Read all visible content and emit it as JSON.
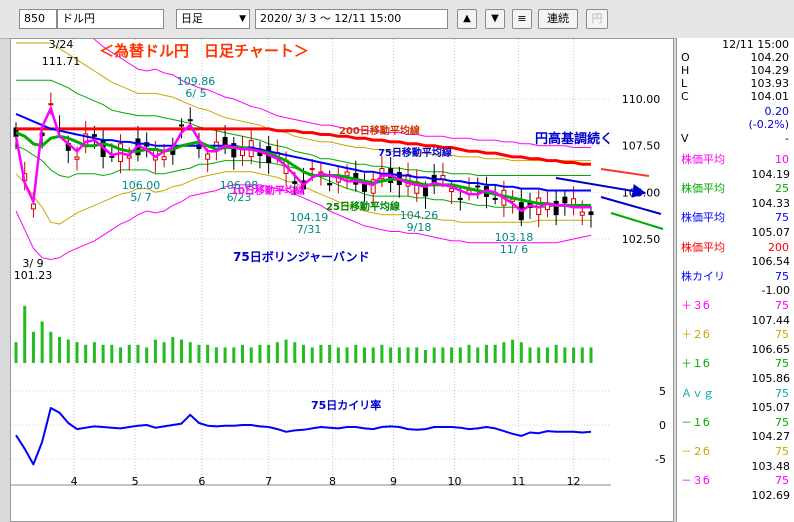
{
  "toolbar": {
    "code": "850",
    "name": "ドル円",
    "period": "日足",
    "date_range": "2020/ 3/ 3 ～ 12/11 15:00",
    "up_button": "▲",
    "down_button": "▼",
    "menu_button": "≡",
    "continuous_button": "連続",
    "yen_button": "円"
  },
  "ohlc": {
    "datetime": "12/11 15:00",
    "rows": [
      {
        "label": "O",
        "value": "104.20"
      },
      {
        "label": "H",
        "value": "104.29"
      },
      {
        "label": "L",
        "value": "103.93"
      },
      {
        "label": "C",
        "value": "104.01"
      }
    ],
    "change": "0.20",
    "change_pct": "(-0.2%)",
    "volume_label": "V",
    "volume_value": "-"
  },
  "indicators": [
    {
      "label": "株価平均",
      "period": "10",
      "value": "104.19",
      "color": "#ff00ff"
    },
    {
      "label": "株価平均",
      "period": "25",
      "value": "104.33",
      "color": "#00aa00"
    },
    {
      "label": "株価平均",
      "period": "75",
      "value": "105.07",
      "color": "#0000ff"
    },
    {
      "label": "株価平均",
      "period": "200",
      "value": "106.54",
      "color": "#ff0000"
    },
    {
      "label": "株カイリ",
      "period": "75",
      "value": "-1.00",
      "color": "#0000ff"
    },
    {
      "label": "＋３б",
      "period": "75",
      "value": "107.44",
      "color": "#ff00ff"
    },
    {
      "label": "＋２б",
      "period": "75",
      "value": "106.65",
      "color": "#c8a800"
    },
    {
      "label": "＋１б",
      "period": "75",
      "value": "105.86",
      "color": "#00aa00"
    },
    {
      "label": "Ａｖｇ",
      "period": "75",
      "value": "105.07",
      "color": "#00aaaa"
    },
    {
      "label": "－１б",
      "period": "75",
      "value": "104.27",
      "color": "#00aa00"
    },
    {
      "label": "－２б",
      "period": "75",
      "value": "103.48",
      "color": "#c8a800"
    },
    {
      "label": "－３б",
      "period": "75",
      "value": "102.69",
      "color": "#ff00ff"
    }
  ],
  "annotations": {
    "title": "＜為替ドル円　日足チャート＞",
    "trend": "円高基調続く",
    "ma200": "200日移動平均線",
    "ma75": "75日移動平均線",
    "ma10": "10日移動平均線",
    "ma25": "25日移動平均線",
    "bollinger": "75日ボリンジャーバンド",
    "deviation": "75日カイリ率"
  },
  "point_labels": [
    {
      "value": "111.71",
      "date": "3/24"
    },
    {
      "value": "101.23",
      "date": "3/ 9"
    },
    {
      "value": "109.86",
      "date": "6/ 5"
    },
    {
      "value": "106.00",
      "date": "5/ 7"
    },
    {
      "value": "106.08",
      "date": "6/23"
    },
    {
      "value": "104.19",
      "date": "7/31"
    },
    {
      "value": "104.26",
      "date": "9/18"
    },
    {
      "value": "103.18",
      "date": "11/ 6"
    }
  ],
  "chart_data": {
    "type": "line",
    "x_ticks": [
      "4",
      "5",
      "6",
      "7",
      "8",
      "9",
      "10",
      "11",
      "12"
    ],
    "price_axis": {
      "ticks": [
        "110.00",
        "107.50",
        "105.00",
        "102.50"
      ],
      "values": [
        110,
        107.5,
        105,
        102.5
      ]
    },
    "deviation_axis": {
      "ticks": [
        "5",
        "0",
        "-5"
      ],
      "values": [
        5,
        0,
        -5
      ]
    },
    "x": [
      0,
      3,
      6,
      9,
      12,
      15,
      18,
      21,
      24,
      27,
      30,
      33,
      36,
      39,
      42,
      45,
      48,
      51,
      54,
      57,
      60,
      63,
      66,
      69,
      72,
      75,
      78,
      81,
      84,
      87,
      90,
      93,
      96,
      99,
      102,
      105,
      108,
      111,
      114,
      117,
      120,
      123,
      126,
      129,
      132,
      135,
      138,
      141,
      144,
      147,
      150,
      153,
      156,
      159,
      162,
      165,
      168,
      171,
      174,
      177,
      180,
      183,
      186,
      189,
      192,
      195,
      198
    ],
    "series": [
      {
        "name": "株価平均 10",
        "color": "#ff00ff",
        "values": [
          108.0,
          105.5,
          104.5,
          108.5,
          109.5,
          108.0,
          107.6,
          107.2,
          107.7,
          107.8,
          107.4,
          107.0,
          107.1,
          107.0,
          107.5,
          107.3,
          106.9,
          107.2,
          107.4,
          108.2,
          108.6,
          107.8,
          107.2,
          107.2,
          107.5,
          107.4,
          107.3,
          107.3,
          107.2,
          107.0,
          106.8,
          106.4,
          105.9,
          105.4,
          105.8,
          106.0,
          105.9,
          105.8,
          105.6,
          105.6,
          105.5,
          105.4,
          105.9,
          105.9,
          105.7,
          105.5,
          105.4,
          105.3,
          105.5,
          105.4,
          105.3,
          105.1,
          104.9,
          104.9,
          105.1,
          105.0,
          104.7,
          104.4,
          104.0,
          104.3,
          104.2,
          104.4,
          104.3,
          104.3,
          104.2,
          104.2,
          104.2
        ]
      },
      {
        "name": "株価平均 25",
        "color": "#00aa00",
        "values": [
          108.2,
          108.0,
          107.6,
          107.5,
          107.9,
          108.0,
          107.9,
          107.7,
          107.5,
          107.5,
          107.6,
          107.5,
          107.3,
          107.2,
          107.2,
          107.3,
          107.3,
          107.2,
          107.3,
          107.5,
          107.6,
          107.7,
          107.5,
          107.3,
          107.4,
          107.4,
          107.4,
          107.3,
          107.2,
          107.1,
          106.9,
          106.7,
          106.4,
          106.1,
          105.9,
          105.9,
          105.9,
          105.9,
          105.8,
          105.7,
          105.6,
          105.5,
          105.6,
          105.7,
          105.7,
          105.6,
          105.5,
          105.4,
          105.4,
          105.4,
          105.4,
          105.3,
          105.2,
          105.1,
          105.0,
          104.9,
          104.8,
          104.7,
          104.6,
          104.5,
          104.4,
          104.4,
          104.3,
          104.3,
          104.3,
          104.3,
          104.3
        ]
      },
      {
        "name": "株価平均 75",
        "color": "#0000ff",
        "values": [
          109.2,
          109.0,
          108.8,
          108.6,
          108.4,
          108.3,
          108.2,
          108.1,
          108.0,
          107.9,
          107.8,
          107.8,
          107.7,
          107.7,
          107.6,
          107.6,
          107.5,
          107.5,
          107.5,
          107.5,
          107.5,
          107.5,
          107.5,
          107.5,
          107.5,
          107.5,
          107.4,
          107.4,
          107.3,
          107.2,
          107.1,
          107.0,
          106.9,
          106.8,
          106.7,
          106.6,
          106.5,
          106.4,
          106.3,
          106.2,
          106.1,
          106.1,
          106.0,
          106.0,
          105.9,
          105.9,
          105.8,
          105.8,
          105.7,
          105.7,
          105.6,
          105.6,
          105.5,
          105.5,
          105.4,
          105.4,
          105.3,
          105.3,
          105.2,
          105.2,
          105.2,
          105.1,
          105.1,
          105.1,
          105.1,
          105.1,
          105.1
        ]
      },
      {
        "name": "株価平均 200",
        "color": "#ff0000",
        "values": [
          108.4,
          108.4,
          108.4,
          108.4,
          108.4,
          108.4,
          108.4,
          108.4,
          108.4,
          108.4,
          108.4,
          108.4,
          108.4,
          108.4,
          108.4,
          108.4,
          108.4,
          108.4,
          108.4,
          108.4,
          108.4,
          108.4,
          108.4,
          108.4,
          108.4,
          108.4,
          108.4,
          108.4,
          108.4,
          108.4,
          108.3,
          108.3,
          108.3,
          108.2,
          108.2,
          108.1,
          108.1,
          108.0,
          108.0,
          107.9,
          107.9,
          107.8,
          107.8,
          107.7,
          107.7,
          107.6,
          107.6,
          107.5,
          107.5,
          107.4,
          107.4,
          107.3,
          107.2,
          107.2,
          107.1,
          107.1,
          107.0,
          106.9,
          106.9,
          106.8,
          106.8,
          106.7,
          106.7,
          106.6,
          106.6,
          106.5,
          106.5
        ]
      },
      {
        "name": "＋３б",
        "color": "#ff00ff",
        "values": [
          115.0,
          115.0,
          115.0,
          115.0,
          115.0,
          114.6,
          114.2,
          113.8,
          113.5,
          113.2,
          112.8,
          112.5,
          112.2,
          111.9,
          111.6,
          111.5,
          111.6,
          111.4,
          111.3,
          111.0,
          110.8,
          110.6,
          110.5,
          110.3,
          110.1,
          110.0,
          109.8,
          109.6,
          109.5,
          109.3,
          109.1,
          109.0,
          108.9,
          108.8,
          108.7,
          108.6,
          108.6,
          108.5,
          108.4,
          108.4,
          108.3,
          108.3,
          108.2,
          108.2,
          108.2,
          108.1,
          108.1,
          108.0,
          108.0,
          108.0,
          107.9,
          107.9,
          107.9,
          107.8,
          107.8,
          107.8,
          107.7,
          107.7,
          107.6,
          107.6,
          107.5,
          107.5,
          107.5,
          107.5,
          107.4,
          107.4,
          107.4
        ]
      },
      {
        "name": "＋２б",
        "color": "#c8a800",
        "values": [
          113.0,
          113.0,
          113.0,
          113.0,
          113.0,
          112.7,
          112.4,
          112.1,
          111.8,
          111.5,
          111.2,
          110.9,
          110.7,
          110.5,
          110.3,
          110.3,
          110.3,
          110.2,
          110.1,
          109.9,
          109.7,
          109.5,
          109.4,
          109.2,
          109.0,
          108.9,
          108.8,
          108.7,
          108.6,
          108.4,
          108.3,
          108.2,
          108.0,
          107.9,
          107.8,
          107.7,
          107.7,
          107.6,
          107.5,
          107.4,
          107.4,
          107.3,
          107.3,
          107.2,
          107.2,
          107.2,
          107.1,
          107.1,
          107.0,
          107.0,
          107.0,
          106.9,
          106.9,
          106.9,
          106.8,
          106.8,
          106.8,
          106.7,
          106.7,
          106.7,
          106.7,
          106.7,
          106.7,
          106.7,
          106.7,
          106.7,
          106.7
        ]
      },
      {
        "name": "＋１б",
        "color": "#00aa00",
        "values": [
          111.0,
          111.0,
          111.0,
          111.0,
          111.0,
          110.8,
          110.6,
          110.3,
          110.1,
          109.9,
          109.7,
          109.4,
          109.3,
          109.2,
          109.1,
          109.1,
          109.1,
          109.0,
          108.9,
          108.8,
          108.7,
          108.5,
          108.4,
          108.3,
          108.2,
          108.1,
          108.0,
          107.9,
          107.8,
          107.6,
          107.5,
          107.4,
          107.2,
          107.1,
          107.0,
          106.8,
          106.8,
          106.7,
          106.6,
          106.5,
          106.5,
          106.4,
          106.4,
          106.3,
          106.3,
          106.2,
          106.2,
          106.1,
          106.1,
          106.1,
          106.0,
          106.0,
          106.0,
          105.9,
          105.9,
          105.9,
          105.9,
          105.9,
          105.9,
          105.9,
          105.9,
          105.9,
          105.9,
          105.9,
          105.9,
          105.9,
          105.9
        ]
      },
      {
        "name": "－１б",
        "color": "#00aa00",
        "values": [
          107.5,
          107.3,
          107.0,
          106.7,
          106.2,
          105.9,
          105.8,
          106.0,
          106.0,
          106.0,
          105.9,
          106.0,
          106.2,
          106.2,
          106.2,
          106.2,
          106.0,
          106.0,
          106.1,
          106.2,
          106.3,
          106.5,
          106.5,
          106.6,
          106.7,
          106.7,
          106.7,
          106.7,
          106.6,
          106.6,
          106.5,
          106.4,
          106.3,
          106.1,
          106.0,
          105.8,
          105.6,
          105.4,
          105.2,
          105.1,
          104.9,
          104.8,
          104.8,
          104.8,
          104.8,
          104.8,
          104.7,
          104.7,
          104.6,
          104.6,
          104.5,
          104.5,
          104.4,
          104.3,
          104.3,
          104.2,
          104.2,
          104.2,
          104.2,
          104.2,
          104.2,
          104.2,
          104.3,
          104.3,
          104.3,
          104.3,
          104.3
        ]
      },
      {
        "name": "－２б",
        "color": "#c8a800",
        "values": [
          106.0,
          105.5,
          104.8,
          104.2,
          103.4,
          103.3,
          103.6,
          103.9,
          104.1,
          104.3,
          104.5,
          104.7,
          104.9,
          105.0,
          105.2,
          105.2,
          105.0,
          105.1,
          105.3,
          105.4,
          105.6,
          105.8,
          105.9,
          106.0,
          106.1,
          106.1,
          106.1,
          106.1,
          106.0,
          105.9,
          105.8,
          105.6,
          105.5,
          105.3,
          105.1,
          104.9,
          104.7,
          104.5,
          104.3,
          104.2,
          104.0,
          103.9,
          103.8,
          103.8,
          103.8,
          103.8,
          103.7,
          103.6,
          103.6,
          103.5,
          103.5,
          103.4,
          103.4,
          103.4,
          103.4,
          103.4,
          103.4,
          103.4,
          103.4,
          103.4,
          103.5,
          103.5,
          103.5,
          103.5,
          103.5,
          103.5,
          103.5
        ]
      },
      {
        "name": "－３б",
        "color": "#ff00ff",
        "values": [
          104.0,
          103.0,
          102.0,
          101.5,
          101.4,
          101.5,
          101.8,
          102.0,
          102.2,
          102.4,
          102.7,
          103.0,
          103.3,
          103.5,
          103.8,
          104.0,
          103.9,
          104.0,
          104.3,
          104.5,
          104.8,
          104.9,
          105.0,
          105.1,
          105.3,
          105.4,
          105.4,
          105.4,
          105.4,
          105.3,
          105.2,
          105.1,
          104.9,
          104.7,
          104.5,
          104.3,
          104.0,
          103.8,
          103.6,
          103.4,
          103.2,
          103.1,
          103.0,
          102.9,
          102.9,
          102.8,
          102.8,
          102.7,
          102.6,
          102.5,
          102.4,
          102.4,
          102.3,
          102.3,
          102.3,
          102.3,
          102.3,
          102.3,
          102.3,
          102.3,
          102.3,
          102.3,
          102.3,
          102.4,
          102.5,
          102.6,
          102.7
        ]
      },
      {
        "name": "75日カイリ率",
        "color": "#0000ff",
        "values": [
          -1.5,
          -3.5,
          -5.8,
          -2.5,
          2.5,
          1.8,
          0.3,
          -0.6,
          -0.4,
          -0.2,
          -0.3,
          -0.4,
          -0.5,
          -0.3,
          -0.1,
          0.0,
          -0.4,
          -0.2,
          0.0,
          0.2,
          1.5,
          0.3,
          -0.1,
          -0.2,
          -0.1,
          -0.1,
          0.0,
          0.0,
          -0.2,
          -0.3,
          -0.6,
          -1.0,
          -0.8,
          -0.7,
          -0.5,
          -0.3,
          -0.4,
          -0.5,
          -0.3,
          -0.3,
          -0.5,
          -0.6,
          -0.3,
          -0.2,
          -0.3,
          -0.6,
          -0.7,
          -0.6,
          -0.3,
          -0.3,
          -0.3,
          -0.4,
          -0.6,
          -0.5,
          -0.3,
          -0.5,
          -0.9,
          -1.3,
          -1.6,
          -1.1,
          -1.2,
          -0.9,
          -1.0,
          -1.0,
          -1.0,
          -1.1,
          -1.0
        ]
      }
    ],
    "volume": [
      8,
      22,
      12,
      16,
      12,
      10,
      9,
      8,
      7,
      8,
      7,
      7,
      6,
      7,
      7,
      6,
      9,
      8,
      10,
      9,
      8,
      7,
      7,
      6,
      6,
      6,
      7,
      6,
      7,
      7,
      8,
      9,
      8,
      7,
      6,
      7,
      7,
      6,
      6,
      7,
      6,
      6,
      7,
      6,
      6,
      6,
      6,
      5,
      6,
      6,
      6,
      6,
      7,
      6,
      7,
      7,
      8,
      9,
      8,
      6,
      6,
      6,
      7,
      6,
      6,
      6,
      6
    ]
  }
}
